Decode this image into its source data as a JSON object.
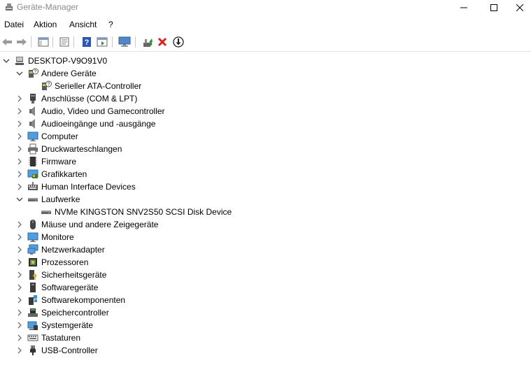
{
  "window": {
    "title": "Geräte-Manager"
  },
  "menu": [
    "Datei",
    "Aktion",
    "Ansicht",
    "?"
  ],
  "tree": {
    "root": "DESKTOP-V9O91V0",
    "categories": [
      {
        "label": "Andere Geräte",
        "icon": "unknown-device-icon",
        "expanded": true,
        "children": [
          "Serieller ATA-Controller"
        ]
      },
      {
        "label": "Anschlüsse (COM & LPT)",
        "icon": "port-icon",
        "expanded": false,
        "children": []
      },
      {
        "label": "Audio, Video und Gamecontroller",
        "icon": "speaker-icon",
        "expanded": false,
        "children": []
      },
      {
        "label": "Audioeingänge und -ausgänge",
        "icon": "speaker-icon",
        "expanded": false,
        "children": []
      },
      {
        "label": "Computer",
        "icon": "monitor-icon",
        "expanded": false,
        "children": []
      },
      {
        "label": "Druckwarteschlangen",
        "icon": "printer-icon",
        "expanded": false,
        "children": []
      },
      {
        "label": "Firmware",
        "icon": "chip-icon",
        "expanded": false,
        "children": []
      },
      {
        "label": "Grafikkarten",
        "icon": "display-adapter-icon",
        "expanded": false,
        "children": []
      },
      {
        "label": "Human Interface Devices",
        "icon": "keyboard-hid-icon",
        "expanded": false,
        "children": []
      },
      {
        "label": "Laufwerke",
        "icon": "disk-drive-icon",
        "expanded": true,
        "children": [
          "NVMe KINGSTON SNV2S50 SCSI Disk Device"
        ]
      },
      {
        "label": "Mäuse und andere Zeigegeräte",
        "icon": "mouse-icon",
        "expanded": false,
        "children": []
      },
      {
        "label": "Monitore",
        "icon": "monitor-icon",
        "expanded": false,
        "children": []
      },
      {
        "label": "Netzwerkadapter",
        "icon": "network-icon",
        "expanded": false,
        "children": []
      },
      {
        "label": "Prozessoren",
        "icon": "processor-icon",
        "expanded": false,
        "children": []
      },
      {
        "label": "Sicherheitsgeräte",
        "icon": "security-key-icon",
        "expanded": false,
        "children": []
      },
      {
        "label": "Softwaregeräte",
        "icon": "software-device-icon",
        "expanded": false,
        "children": []
      },
      {
        "label": "Softwarekomponenten",
        "icon": "software-component-icon",
        "expanded": false,
        "children": []
      },
      {
        "label": "Speichercontroller",
        "icon": "storage-controller-icon",
        "expanded": false,
        "children": []
      },
      {
        "label": "Systemgeräte",
        "icon": "system-device-icon",
        "expanded": false,
        "children": []
      },
      {
        "label": "Tastaturen",
        "icon": "keyboard-icon",
        "expanded": false,
        "children": []
      },
      {
        "label": "USB-Controller",
        "icon": "usb-icon",
        "expanded": false,
        "children": []
      }
    ]
  }
}
